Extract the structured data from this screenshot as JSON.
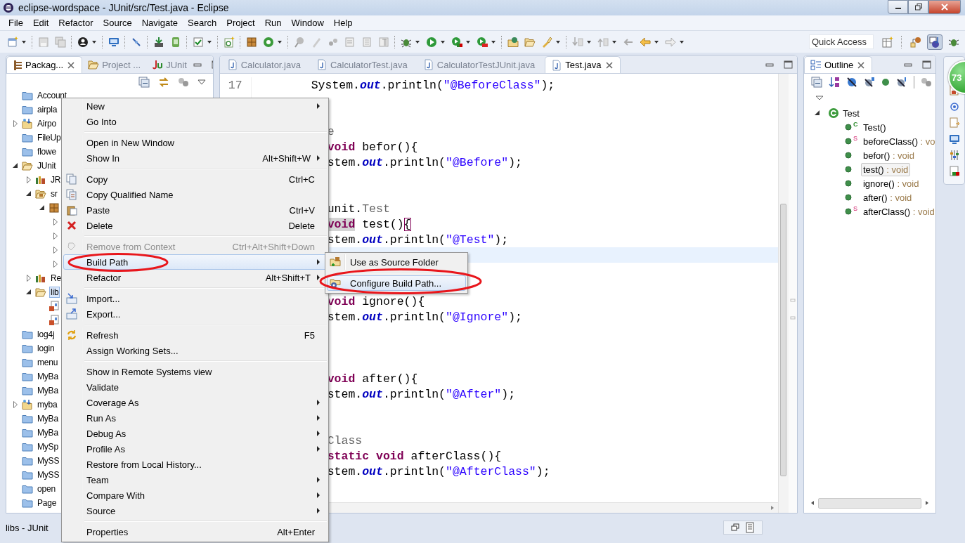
{
  "window": {
    "title": "eclipse-wordspace - JUnit/src/Test.java - Eclipse"
  },
  "menu_bar": [
    "File",
    "Edit",
    "Refactor",
    "Source",
    "Navigate",
    "Search",
    "Project",
    "Run",
    "Window",
    "Help"
  ],
  "toolbar": {
    "quick_access": {
      "placeholder": "Quick Access"
    }
  },
  "package_explorer": {
    "tabs": [
      {
        "label": "Packag...",
        "selected": true,
        "closable": true
      },
      {
        "label": "Project ...",
        "selected": false,
        "closable": false
      },
      {
        "label": "JUnit",
        "selected": false,
        "closable": false
      }
    ],
    "tree": [
      {
        "label": "Account",
        "kind": "folder",
        "selected": false
      },
      {
        "label": "airpla",
        "kind": "folder",
        "selected": false
      },
      {
        "label": "Airpo",
        "kind": "project",
        "expanded": false,
        "selected": false
      },
      {
        "label": "FileUp",
        "kind": "folder",
        "selected": false
      },
      {
        "label": "flowe",
        "kind": "folder",
        "selected": false
      },
      {
        "label": "JUnit",
        "kind": "open-folder",
        "expanded": true,
        "selected": false,
        "children": [
          {
            "label": "JR",
            "kind": "library",
            "expanded": false,
            "selected": false
          },
          {
            "label": "sr",
            "kind": "source-folder",
            "expanded": true,
            "selected": false,
            "children": [
              {
                "kind": "package",
                "expanded": true,
                "children": [
                  {
                    "expanded": false
                  },
                  {
                    "expanded": false
                  },
                  {
                    "expanded": false
                  },
                  {
                    "expanded": false
                  }
                ]
              }
            ]
          },
          {
            "label": "Re",
            "kind": "library",
            "expanded": false,
            "selected": false
          },
          {
            "label": "lib",
            "kind": "open-folder",
            "expanded": true,
            "selected": true,
            "children": [
              {
                "kind": "jar"
              },
              {
                "kind": "jar"
              }
            ]
          }
        ]
      },
      {
        "label": "log4j",
        "kind": "folder",
        "selected": false
      },
      {
        "label": "login",
        "kind": "folder",
        "selected": false
      },
      {
        "label": "menu",
        "kind": "folder",
        "selected": false
      },
      {
        "label": "MyBa",
        "kind": "folder",
        "selected": false
      },
      {
        "label": "MyBa",
        "kind": "folder",
        "selected": false
      },
      {
        "label": "myba",
        "kind": "project",
        "expanded": false,
        "selected": false
      },
      {
        "label": "MyBa",
        "kind": "folder",
        "selected": false
      },
      {
        "label": "MyBa",
        "kind": "folder",
        "selected": false
      },
      {
        "label": "MySp",
        "kind": "folder",
        "selected": false
      },
      {
        "label": "MySS",
        "kind": "folder",
        "selected": false
      },
      {
        "label": "MySS",
        "kind": "folder",
        "selected": false
      },
      {
        "label": "open",
        "kind": "folder",
        "selected": false
      },
      {
        "label": "Page",
        "kind": "folder",
        "selected": false
      }
    ]
  },
  "editor": {
    "tabs": [
      {
        "label": "Calculator.java",
        "selected": false,
        "closable": false
      },
      {
        "label": "CalculatorTest.java",
        "selected": false,
        "closable": false
      },
      {
        "label": "CalculatorTestJUnit.java",
        "selected": false,
        "closable": false
      },
      {
        "label": "Test.java",
        "selected": true,
        "closable": true
      }
    ],
    "lines": [
      {
        "kind": "full",
        "number": "17",
        "tokens": [
          {
            "text": "System.",
            "kind": "plain"
          },
          {
            "text": "out",
            "kind": "field"
          },
          {
            "text": ".println(",
            "kind": "plain"
          },
          {
            "text": "\"@BeforeClass\"",
            "kind": "string"
          },
          {
            "text": ");",
            "kind": "plain"
          }
        ]
      },
      {
        "kind": "blank"
      },
      {
        "kind": "blank"
      },
      {
        "kind": "cut",
        "tokens": [
          {
            "text": "e",
            "kind": "annotation"
          }
        ]
      },
      {
        "kind": "cut",
        "tokens": [
          {
            "text": "void",
            "kind": "keyword"
          },
          {
            "text": " befor(){",
            "kind": "plain"
          }
        ]
      },
      {
        "kind": "cut",
        "tokens": [
          {
            "text": "stem.",
            "kind": "plain"
          },
          {
            "text": "out",
            "kind": "field"
          },
          {
            "text": ".println(",
            "kind": "plain"
          },
          {
            "text": "\"@Before\"",
            "kind": "string"
          },
          {
            "text": ");",
            "kind": "plain"
          }
        ]
      },
      {
        "kind": "blank"
      },
      {
        "kind": "blank"
      },
      {
        "kind": "cut",
        "tokens": [
          {
            "text": "unit.",
            "kind": "plain"
          },
          {
            "text": "Test",
            "kind": "annotation"
          }
        ]
      },
      {
        "kind": "cut",
        "tokens": [
          {
            "text": "void",
            "kind": "keyword",
            "highlighted": true
          },
          {
            "text": " test()",
            "kind": "plain"
          },
          {
            "text": "{",
            "kind": "bracket"
          }
        ]
      },
      {
        "kind": "cut",
        "tokens": [
          {
            "text": "stem.",
            "kind": "plain"
          },
          {
            "text": "out",
            "kind": "field"
          },
          {
            "text": ".println(",
            "kind": "plain"
          },
          {
            "text": "\"@Test\"",
            "kind": "string"
          },
          {
            "text": ");",
            "kind": "plain"
          }
        ]
      },
      {
        "kind": "blank",
        "current": true
      },
      {
        "kind": "blank"
      },
      {
        "kind": "blank"
      },
      {
        "kind": "cut",
        "tokens": [
          {
            "text": "void",
            "kind": "keyword"
          },
          {
            "text": " ignore(){",
            "kind": "plain"
          }
        ]
      },
      {
        "kind": "cut",
        "tokens": [
          {
            "text": "stem.",
            "kind": "plain"
          },
          {
            "text": "out",
            "kind": "field"
          },
          {
            "text": ".println(",
            "kind": "plain"
          },
          {
            "text": "\"@Ignore\"",
            "kind": "string"
          },
          {
            "text": ");",
            "kind": "plain"
          }
        ]
      },
      {
        "kind": "blank"
      },
      {
        "kind": "blank"
      },
      {
        "kind": "blank"
      },
      {
        "kind": "cut",
        "tokens": [
          {
            "text": "void",
            "kind": "keyword"
          },
          {
            "text": " after(){",
            "kind": "plain"
          }
        ]
      },
      {
        "kind": "cut",
        "tokens": [
          {
            "text": "stem.",
            "kind": "plain"
          },
          {
            "text": "out",
            "kind": "field"
          },
          {
            "text": ".println(",
            "kind": "plain"
          },
          {
            "text": "\"@After\"",
            "kind": "string"
          },
          {
            "text": ");",
            "kind": "plain"
          }
        ]
      },
      {
        "kind": "blank"
      },
      {
        "kind": "blank"
      },
      {
        "kind": "cut",
        "tokens": [
          {
            "text": "Class",
            "kind": "annotation"
          }
        ]
      },
      {
        "kind": "cut",
        "tokens": [
          {
            "text": "static void",
            "kind": "keyword"
          },
          {
            "text": " afterClass(){",
            "kind": "plain"
          }
        ]
      },
      {
        "kind": "cut",
        "tokens": [
          {
            "text": "stem.",
            "kind": "plain"
          },
          {
            "text": "out",
            "kind": "field"
          },
          {
            "text": ".println(",
            "kind": "plain"
          },
          {
            "text": "\"@AfterClass\"",
            "kind": "string"
          },
          {
            "text": ");",
            "kind": "plain"
          }
        ]
      }
    ]
  },
  "outline": {
    "tabs": [
      {
        "label": "Outline",
        "selected": true,
        "closable": true
      }
    ],
    "tree": [
      {
        "label": "Test",
        "expanded": true,
        "selected": false,
        "children": [
          {
            "name": "Test()",
            "modifier": "C",
            "selected": false
          },
          {
            "name": "beforeClass()",
            "type": ": vo",
            "modifier": "S",
            "selected": false
          },
          {
            "name": "befor()",
            "type": ": void",
            "selected": false
          },
          {
            "name": "test()",
            "type": ": void",
            "selected": true
          },
          {
            "name": "ignore()",
            "type": ": void",
            "selected": false
          },
          {
            "name": "after()",
            "type": ": void",
            "selected": false
          },
          {
            "name": "afterClass()",
            "type": ": void",
            "modifier": "S",
            "selected": false
          }
        ]
      }
    ]
  },
  "context_menu": {
    "items": [
      {
        "kind": "item",
        "label": "New",
        "submenu": true,
        "disabled": false,
        "selected": false
      },
      {
        "kind": "item",
        "label": "Go Into",
        "submenu": false,
        "disabled": false,
        "selected": false
      },
      {
        "kind": "separator"
      },
      {
        "kind": "item",
        "label": "Open in New Window",
        "submenu": false,
        "disabled": false,
        "selected": false
      },
      {
        "kind": "item",
        "label": "Show In",
        "shortcut": "Alt+Shift+W",
        "submenu": true,
        "disabled": false,
        "selected": false
      },
      {
        "kind": "separator"
      },
      {
        "kind": "item",
        "label": "Copy",
        "shortcut": "Ctrl+C",
        "submenu": false,
        "disabled": false,
        "selected": false
      },
      {
        "kind": "item",
        "label": "Copy Qualified Name",
        "submenu": false,
        "disabled": false,
        "selected": false
      },
      {
        "kind": "item",
        "label": "Paste",
        "shortcut": "Ctrl+V",
        "submenu": false,
        "disabled": false,
        "selected": false
      },
      {
        "kind": "item",
        "label": "Delete",
        "shortcut": "Delete",
        "submenu": false,
        "disabled": false,
        "selected": false
      },
      {
        "kind": "separator"
      },
      {
        "kind": "item",
        "label": "Remove from Context",
        "shortcut": "Ctrl+Alt+Shift+Down",
        "submenu": false,
        "disabled": true,
        "selected": false
      },
      {
        "kind": "item",
        "label": "Build Path",
        "submenu": true,
        "disabled": false,
        "selected": true
      },
      {
        "kind": "item",
        "label": "Refactor",
        "shortcut": "Alt+Shift+T",
        "submenu": true,
        "disabled": false,
        "selected": false
      },
      {
        "kind": "separator"
      },
      {
        "kind": "item",
        "label": "Import...",
        "submenu": false,
        "disabled": false,
        "selected": false
      },
      {
        "kind": "item",
        "label": "Export...",
        "submenu": false,
        "disabled": false,
        "selected": false
      },
      {
        "kind": "separator"
      },
      {
        "kind": "item",
        "label": "Refresh",
        "shortcut": "F5",
        "submenu": false,
        "disabled": false,
        "selected": false
      },
      {
        "kind": "item",
        "label": "Assign Working Sets...",
        "submenu": false,
        "disabled": false,
        "selected": false
      },
      {
        "kind": "separator"
      },
      {
        "kind": "item",
        "label": "Show in Remote Systems view",
        "submenu": false,
        "disabled": false,
        "selected": false
      },
      {
        "kind": "item",
        "label": "Validate",
        "submenu": false,
        "disabled": false,
        "selected": false
      },
      {
        "kind": "item",
        "label": "Coverage As",
        "submenu": true,
        "disabled": false,
        "selected": false
      },
      {
        "kind": "item",
        "label": "Run As",
        "submenu": true,
        "disabled": false,
        "selected": false
      },
      {
        "kind": "item",
        "label": "Debug As",
        "submenu": true,
        "disabled": false,
        "selected": false
      },
      {
        "kind": "item",
        "label": "Profile As",
        "submenu": true,
        "disabled": false,
        "selected": false
      },
      {
        "kind": "item",
        "label": "Restore from Local History...",
        "submenu": false,
        "disabled": false,
        "selected": false
      },
      {
        "kind": "item",
        "label": "Team",
        "submenu": true,
        "disabled": false,
        "selected": false
      },
      {
        "kind": "item",
        "label": "Compare With",
        "submenu": true,
        "disabled": false,
        "selected": false
      },
      {
        "kind": "item",
        "label": "Source",
        "submenu": true,
        "disabled": false,
        "selected": false
      },
      {
        "kind": "separator"
      },
      {
        "kind": "item",
        "label": "Properties",
        "shortcut": "Alt+Enter",
        "submenu": false,
        "disabled": false,
        "selected": false
      }
    ]
  },
  "submenu": {
    "items": [
      {
        "kind": "item",
        "label": "Use as Source Folder",
        "submenu": false,
        "disabled": false,
        "selected": false
      },
      {
        "kind": "separator"
      },
      {
        "kind": "item",
        "label": "Configure Build Path...",
        "submenu": false,
        "disabled": false,
        "selected": true
      }
    ]
  },
  "status_bar": {
    "text": "libs - JUnit"
  },
  "notification_badge": {
    "text": "73"
  }
}
